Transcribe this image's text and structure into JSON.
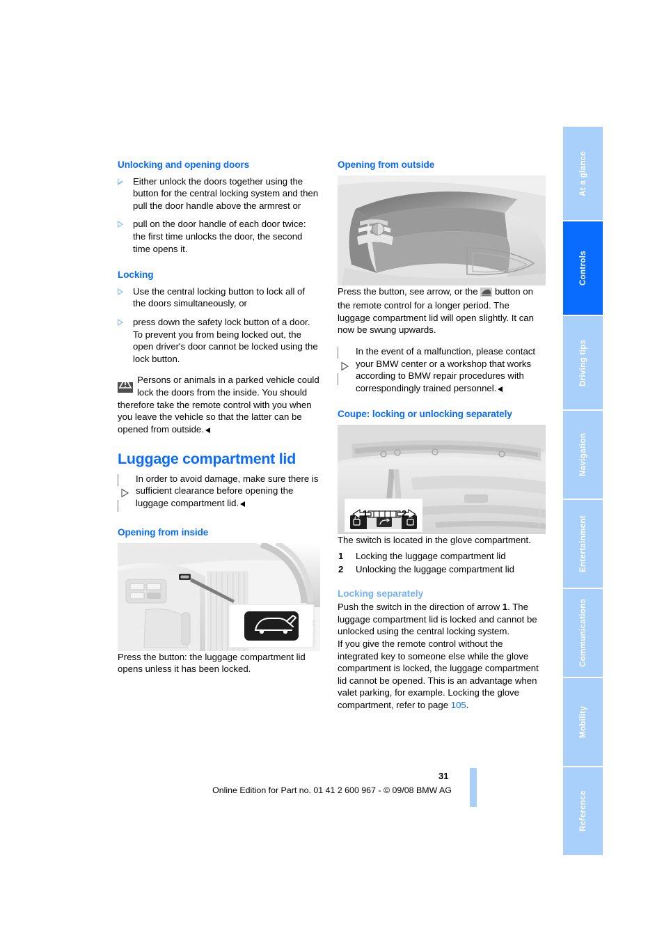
{
  "document": {
    "page_number": "31",
    "imprint": "Online Edition for Part no. 01 41 2 600 967  - © 09/08 BMW AG"
  },
  "colors": {
    "heading_blue": "#0a6bff",
    "subheading_blue": "#72b1f7",
    "tab_inactive": "#a9d0fb",
    "tab_active": "#0a6bff"
  },
  "sidebar": {
    "tabs": [
      {
        "label": "At a glance",
        "active": false
      },
      {
        "label": "Controls",
        "active": true
      },
      {
        "label": "Driving tips",
        "active": false
      },
      {
        "label": "Navigation",
        "active": false
      },
      {
        "label": "Entertainment",
        "active": false
      },
      {
        "label": "Communications",
        "active": false
      },
      {
        "label": "Mobility",
        "active": false
      },
      {
        "label": "Reference",
        "active": false
      }
    ]
  },
  "left_column": {
    "section1": {
      "heading": "Unlocking and opening doors",
      "bullets": [
        "Either unlock the doors together using the button for the central locking system and then pull the door handle above the armrest or",
        "pull on the door handle of each door twice: the first time unlocks the door, the second time opens it."
      ]
    },
    "section2": {
      "heading": "Locking",
      "bullets": [
        "Use the central locking button to lock all of the doors simultaneously, or",
        "press down the safety lock button of a door. To prevent you from being locked out, the open driver's door cannot be locked using the lock button."
      ],
      "warning": "Persons or animals in a parked vehicle could lock the doors from the inside. You should therefore take the remote control with you when you leave the vehicle so that the latter can be opened from outside."
    },
    "title": "Luggage compartment lid",
    "title_note": "In order to avoid damage, make sure there is sufficient clearance before opening the luggage compartment lid.",
    "section3": {
      "heading": "Opening from inside",
      "figure_code": "MAPP0106205",
      "caption": "Press the button: the luggage compartment lid opens unless it has been locked."
    }
  },
  "right_column": {
    "section1": {
      "heading": "Opening from outside",
      "figure_code": "MAP0011W05",
      "paragraph_part1": "Press the button, see arrow, or the",
      "paragraph_part2": "button on the remote control for a longer period. The luggage compartment lid will open slightly. It can now be swung upwards.",
      "note": "In the event of a malfunction, please contact your BMW center or a workshop that works according to BMW repair procedures with correspondingly trained personnel."
    },
    "section2": {
      "heading": "Coupe: locking or unlocking separately",
      "figure_code": "MAP0111W04",
      "figure_labels": {
        "label1": "1",
        "label2": "2"
      },
      "intro": "The switch is located in the glove compartment.",
      "legend": [
        {
          "num": "1",
          "text": "Locking the luggage compartment lid"
        },
        {
          "num": "2",
          "text": "Unlocking the luggage compartment lid"
        }
      ]
    },
    "section3": {
      "subheading": "Locking separately",
      "paragraph1_pre": "Push the switch in the direction of arrow ",
      "paragraph1_num": "1",
      "paragraph1_post": ". The luggage compartment lid is locked and cannot be unlocked using the central locking system.",
      "paragraph2_pre": "If you give the remote control without the integrated key to someone else while the glove compartment is locked, the luggage compartment lid cannot be opened. This is an advantage when valet parking, for example. Locking the glove compartment, refer to page ",
      "paragraph2_pageref": "105",
      "paragraph2_post": "."
    }
  },
  "icons": {
    "note": "note-play-triangle-icon",
    "warning": "warning-triangle-icon",
    "bullet": "bullet-triangle-icon",
    "end_of_section": "end-of-section-marker",
    "trunk_button": "trunk-release-icon",
    "lock": "padlock-closed-icon",
    "unlock": "padlock-open-icon"
  }
}
